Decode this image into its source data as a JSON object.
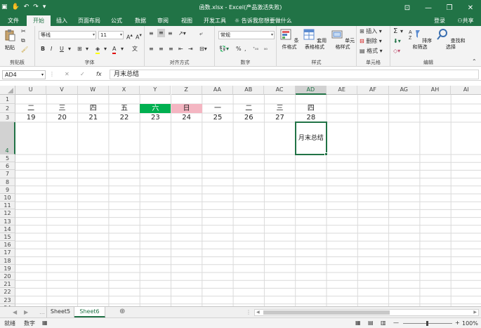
{
  "window": {
    "title": "函数.xlsx - Excel(产品激活失败)",
    "login": "登录",
    "share": "共享"
  },
  "tabs": [
    "文件",
    "开始",
    "插入",
    "页面布局",
    "公式",
    "数据",
    "审阅",
    "视图",
    "开发工具"
  ],
  "tell_me": "告诉我您想要做什么",
  "ribbon": {
    "clipboard": {
      "paste": "粘贴",
      "label": "剪贴板"
    },
    "font": {
      "name": "等线",
      "size": "11",
      "label": "字体"
    },
    "alignment": {
      "label": "对齐方式"
    },
    "number": {
      "format": "常规",
      "label": "数字"
    },
    "styles": {
      "conditional": "条件格式",
      "table1": "套用",
      "table2": "表格格式",
      "cell": "单元格样式",
      "label": "样式"
    },
    "cells": {
      "insert": "插入",
      "delete": "删除",
      "format": "格式",
      "label": "单元格"
    },
    "editing": {
      "sum": "Σ",
      "sort": "排序和筛选",
      "find": "查找和选择",
      "label": "编辑"
    }
  },
  "formula_bar": {
    "name_box": "AD4",
    "fx": "fx",
    "value": "月末总结"
  },
  "columns": [
    "U",
    "V",
    "W",
    "X",
    "Y",
    "Z",
    "AA",
    "AB",
    "AC",
    "AD",
    "AE",
    "AF",
    "AG",
    "AH",
    "AI"
  ],
  "rows": [
    "1",
    "2",
    "3",
    "4",
    "5",
    "6",
    "7",
    "8",
    "9",
    "10",
    "11",
    "12",
    "13",
    "14",
    "15",
    "16",
    "17",
    "18",
    "19",
    "20",
    "21",
    "22",
    "23",
    "24",
    "25"
  ],
  "cells": {
    "row2": [
      "二",
      "三",
      "四",
      "五",
      "六",
      "日",
      "一",
      "二",
      "三",
      "四"
    ],
    "row3": [
      "19",
      "20",
      "21",
      "22",
      "23",
      "24",
      "25",
      "26",
      "27",
      "28"
    ],
    "ad4": "月末总结"
  },
  "colors": {
    "accent": "#217346",
    "saturday_fill": "#00b050",
    "sunday_fill": "#f4b6c2"
  },
  "sheets": [
    "Sheet5",
    "Sheet6"
  ],
  "active_sheet": "Sheet6",
  "status": {
    "mode": "就绪",
    "numlock": "数字",
    "zoom": "100%"
  }
}
